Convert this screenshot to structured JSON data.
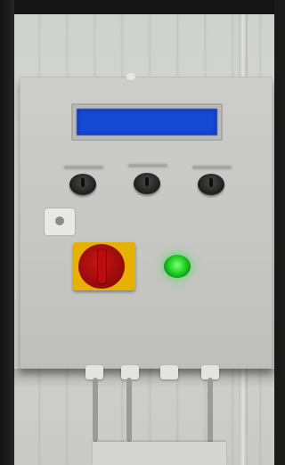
{
  "scene": {
    "subject": "control-cabinet",
    "accent_colors": {
      "lcd_blue": "#1648d6",
      "indicator_green": "#1fd321",
      "isolator_red": "#c91313",
      "isolator_yellow": "#e6b100",
      "cabinet_gray": "#c6c7c3"
    },
    "lcd": {
      "line1": "",
      "line2": ""
    },
    "controls": {
      "knob_count": 3,
      "indicator_state": "on"
    }
  }
}
